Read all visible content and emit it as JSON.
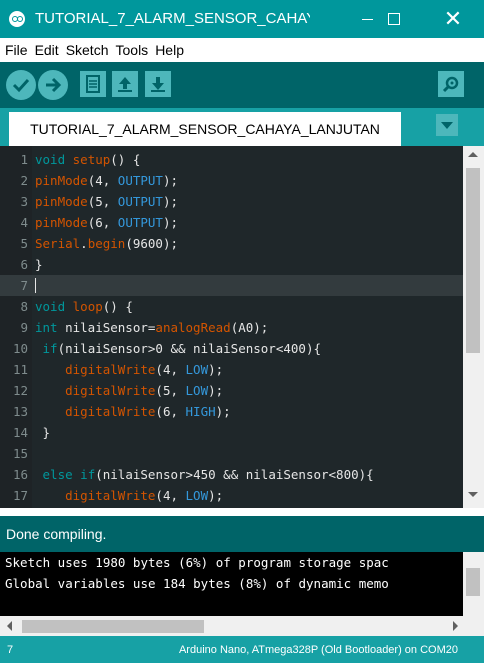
{
  "window": {
    "title": "TUTORIAL_7_ALARM_SENSOR_CAHAYA..."
  },
  "colors": {
    "brand": "#00979c",
    "toolbar": "#006468",
    "editor_bg": "#1f272a",
    "keyword_orange": "#d35400",
    "constant_blue": "#3498db"
  },
  "menu": [
    "File",
    "Edit",
    "Sketch",
    "Tools",
    "Help"
  ],
  "toolbar": {
    "buttons": [
      {
        "name": "verify",
        "icon": "check-icon"
      },
      {
        "name": "upload",
        "icon": "arrow-right-icon"
      },
      {
        "name": "new",
        "icon": "document-icon"
      },
      {
        "name": "open",
        "icon": "arrow-up-icon"
      },
      {
        "name": "save",
        "icon": "arrow-down-icon"
      },
      {
        "name": "serial-monitor",
        "icon": "magnifier-icon"
      }
    ]
  },
  "tabs": [
    {
      "label": "TUTORIAL_7_ALARM_SENSOR_CAHAYA_LANJUTAN",
      "active": true
    }
  ],
  "editor": {
    "current_line": 7,
    "lines": [
      {
        "num": "1",
        "segments": [
          {
            "t": "void",
            "c": "teal"
          },
          {
            "t": " ",
            "c": "plain"
          },
          {
            "t": "setup",
            "c": "orange"
          },
          {
            "t": "() {",
            "c": "plain"
          }
        ]
      },
      {
        "num": "2",
        "segments": [
          {
            "t": "pinMode",
            "c": "orange"
          },
          {
            "t": "(4, ",
            "c": "plain"
          },
          {
            "t": "OUTPUT",
            "c": "blue"
          },
          {
            "t": ");",
            "c": "plain"
          }
        ]
      },
      {
        "num": "3",
        "segments": [
          {
            "t": "pinMode",
            "c": "orange"
          },
          {
            "t": "(5, ",
            "c": "plain"
          },
          {
            "t": "OUTPUT",
            "c": "blue"
          },
          {
            "t": ");",
            "c": "plain"
          }
        ]
      },
      {
        "num": "4",
        "segments": [
          {
            "t": "pinMode",
            "c": "orange"
          },
          {
            "t": "(6, ",
            "c": "plain"
          },
          {
            "t": "OUTPUT",
            "c": "blue"
          },
          {
            "t": ");",
            "c": "plain"
          }
        ]
      },
      {
        "num": "5",
        "segments": [
          {
            "t": "Serial",
            "c": "orange"
          },
          {
            "t": ".",
            "c": "plain"
          },
          {
            "t": "begin",
            "c": "orange"
          },
          {
            "t": "(9600);",
            "c": "plain"
          }
        ]
      },
      {
        "num": "6",
        "segments": [
          {
            "t": "}",
            "c": "plain"
          }
        ]
      },
      {
        "num": "7",
        "segments": []
      },
      {
        "num": "8",
        "segments": [
          {
            "t": "void",
            "c": "teal"
          },
          {
            "t": " ",
            "c": "plain"
          },
          {
            "t": "loop",
            "c": "orange"
          },
          {
            "t": "() {",
            "c": "plain"
          }
        ]
      },
      {
        "num": "9",
        "segments": [
          {
            "t": "int",
            "c": "teal"
          },
          {
            "t": " nilaiSensor=",
            "c": "plain"
          },
          {
            "t": "analogRead",
            "c": "orange"
          },
          {
            "t": "(A0);",
            "c": "plain"
          }
        ]
      },
      {
        "num": "10",
        "segments": [
          {
            "t": " ",
            "c": "plain"
          },
          {
            "t": "if",
            "c": "teal"
          },
          {
            "t": "(nilaiSensor>0 && nilaiSensor<400){",
            "c": "plain"
          }
        ]
      },
      {
        "num": "11",
        "segments": [
          {
            "t": "    ",
            "c": "plain"
          },
          {
            "t": "digitalWrite",
            "c": "orange"
          },
          {
            "t": "(4, ",
            "c": "plain"
          },
          {
            "t": "LOW",
            "c": "blue"
          },
          {
            "t": ");",
            "c": "plain"
          }
        ]
      },
      {
        "num": "12",
        "segments": [
          {
            "t": "    ",
            "c": "plain"
          },
          {
            "t": "digitalWrite",
            "c": "orange"
          },
          {
            "t": "(5, ",
            "c": "plain"
          },
          {
            "t": "LOW",
            "c": "blue"
          },
          {
            "t": ");",
            "c": "plain"
          }
        ]
      },
      {
        "num": "13",
        "segments": [
          {
            "t": "    ",
            "c": "plain"
          },
          {
            "t": "digitalWrite",
            "c": "orange"
          },
          {
            "t": "(6, ",
            "c": "plain"
          },
          {
            "t": "HIGH",
            "c": "blue"
          },
          {
            "t": ");",
            "c": "plain"
          }
        ]
      },
      {
        "num": "14",
        "segments": [
          {
            "t": " }",
            "c": "plain"
          }
        ]
      },
      {
        "num": "15",
        "segments": []
      },
      {
        "num": "16",
        "segments": [
          {
            "t": " ",
            "c": "plain"
          },
          {
            "t": "else",
            "c": "teal"
          },
          {
            "t": " ",
            "c": "plain"
          },
          {
            "t": "if",
            "c": "teal"
          },
          {
            "t": "(nilaiSensor>450 && nilaiSensor<800){",
            "c": "plain"
          }
        ]
      },
      {
        "num": "17",
        "segments": [
          {
            "t": "    ",
            "c": "plain"
          },
          {
            "t": "digitalWrite",
            "c": "orange"
          },
          {
            "t": "(4, ",
            "c": "plain"
          },
          {
            "t": "LOW",
            "c": "blue"
          },
          {
            "t": ");",
            "c": "plain"
          }
        ]
      }
    ]
  },
  "status": {
    "message": "Done compiling."
  },
  "console": {
    "lines": [
      "Sketch uses 1980 bytes (6%) of program storage spac",
      "Global variables use 184 bytes (8%) of dynamic memo"
    ]
  },
  "footer": {
    "line_number": "7",
    "board": "Arduino Nano, ATmega328P (Old Bootloader) on COM20"
  }
}
